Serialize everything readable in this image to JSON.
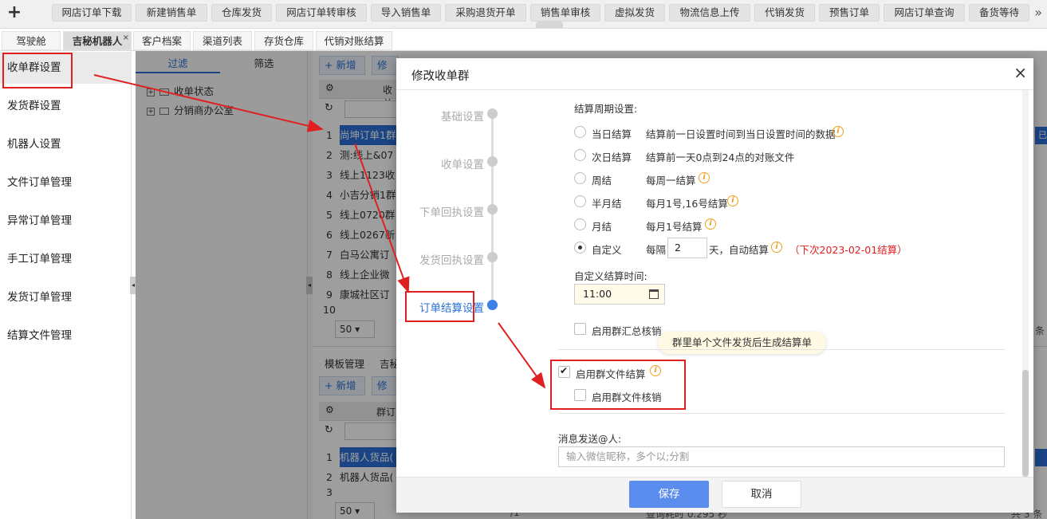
{
  "toolbar": {
    "add_symbol": "+",
    "buttons": [
      "网店订单下载",
      "新建销售单",
      "仓库发货",
      "网店订单转审核",
      "导入销售单",
      "采购退货开单",
      "销售单审核",
      "虚拟发货",
      "物流信息上传",
      "代销发货",
      "预售订单",
      "网店订单查询",
      "备货等待"
    ],
    "more_symbol": "»"
  },
  "tabs": [
    {
      "label": "驾驶舱"
    },
    {
      "label": "吉秘机器人",
      "active": true,
      "close": "×"
    },
    {
      "label": "客户档案"
    },
    {
      "label": "渠道列表"
    },
    {
      "label": "存货仓库"
    },
    {
      "label": "代销对账结算"
    }
  ],
  "sidebar": {
    "items": [
      {
        "label": "收单群设置",
        "active": true
      },
      {
        "label": "发货群设置"
      },
      {
        "label": "机器人设置"
      },
      {
        "label": "文件订单管理"
      },
      {
        "label": "异常订单管理"
      },
      {
        "label": "手工订单管理"
      },
      {
        "label": "发货订单管理"
      },
      {
        "label": "结算文件管理"
      }
    ]
  },
  "filter_panel": {
    "tab_filter": "过滤",
    "tab_select": "筛选",
    "tree": [
      {
        "label": "收单状态",
        "expander": "+"
      },
      {
        "label": "分销商办公室",
        "expander": "+"
      }
    ]
  },
  "grid": {
    "new_button": "+ 新增",
    "edit_button_partial": "修",
    "header_partial": "收单",
    "rows": [
      {
        "num": "1",
        "name": "尚坤订单1群"
      },
      {
        "num": "2",
        "name": "测:线上&07"
      },
      {
        "num": "3",
        "name": "线上1123收"
      },
      {
        "num": "4",
        "name": "小吉分销1群"
      },
      {
        "num": "5",
        "name": "线上0720群"
      },
      {
        "num": "6",
        "name": "线上0267新"
      },
      {
        "num": "7",
        "name": "白马公寓订"
      },
      {
        "num": "8",
        "name": "线上企业微"
      },
      {
        "num": "9",
        "name": "康城社区订"
      },
      {
        "num": "10",
        "name": ""
      }
    ],
    "page_size": "50",
    "right_label_1": "已结",
    "right_label_2": "条",
    "bottom_tabs": [
      "模板管理",
      "吉秘"
    ],
    "bottom_new_button": "+ 新增",
    "bottom_header_partial": "群订",
    "bottom_rows": [
      {
        "num": "1",
        "name": "机器人货品(",
        "selected": true
      },
      {
        "num": "2",
        "name": "机器人货品("
      },
      {
        "num": "3",
        "name": ""
      }
    ],
    "bottom_page_size": "50",
    "bottom_pager_partial": "/1",
    "bottom_query_time": "查询耗时 0.295 秒",
    "bottom_total": "共 3 条"
  },
  "modal": {
    "title": "修改收单群",
    "close": "×",
    "steps": [
      {
        "label": "基础设置"
      },
      {
        "label": "收单设置"
      },
      {
        "label": "下单回执设置"
      },
      {
        "label": "发货回执设置"
      },
      {
        "label": "订单结算设置",
        "active": true
      }
    ],
    "cycle_label": "结算周期设置:",
    "options": [
      {
        "label": "当日结算",
        "desc": "结算前一日设置时间到当日设置时间的数据",
        "info": true
      },
      {
        "label": "次日结算",
        "desc": "结算前一天0点到24点的对账文件",
        "info": false
      },
      {
        "label": "周结",
        "desc": "每周一结算",
        "info": true
      },
      {
        "label": "半月结",
        "desc": "每月1号,16号结算",
        "info": true
      },
      {
        "label": "月结",
        "desc": "每月1号结算",
        "info": true
      },
      {
        "label": "自定义",
        "desc_prefix": "每隔",
        "value": "2",
        "desc_suffix": "天，自动结算",
        "info": true,
        "checked": true,
        "next_text": "（下次2023-02-01结算）"
      }
    ],
    "custom_time_label": "自定义结算时间:",
    "custom_time_value": "11:00",
    "enable_summary_check": "启用群汇总核销",
    "tooltip": "群里单个文件发货后生成结算单",
    "enable_file_settle": "启用群文件结算",
    "enable_file_settle_checked": true,
    "enable_file_check": "启用群文件核销",
    "notify_label": "消息发送@人:",
    "notify_placeholder": "输入微信昵称，多个以;分割",
    "save_button": "保存",
    "cancel_button": "取消"
  },
  "colors": {
    "accent": "#2a6fd6",
    "annotation": "#e02020",
    "info": "#f0a020",
    "save": "#5b8def"
  }
}
